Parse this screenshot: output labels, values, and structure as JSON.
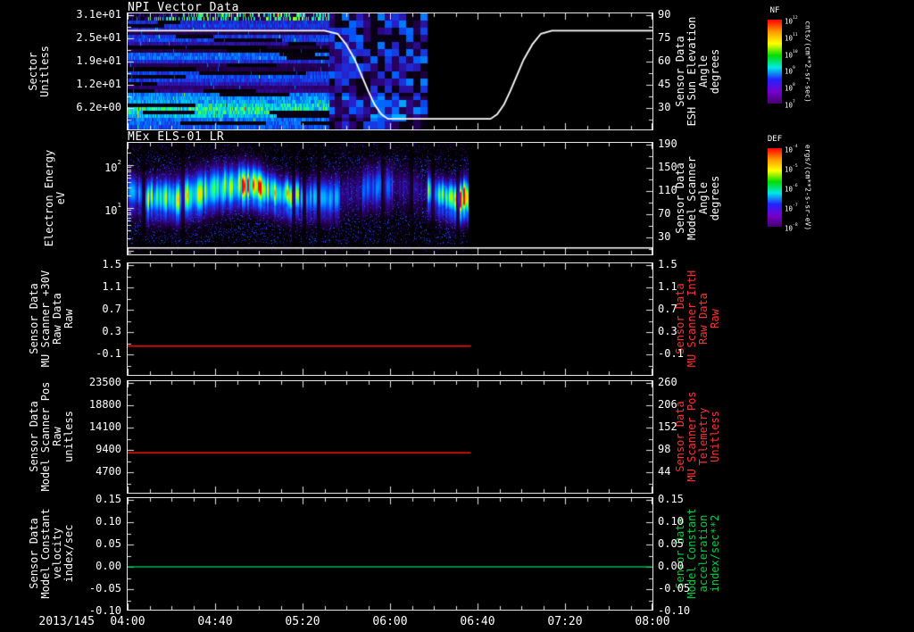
{
  "window": {
    "background": "#000000",
    "foreground": "#ffffff"
  },
  "x_axis": {
    "date_label": "2013/145",
    "tick_labels": [
      "04:00",
      "04:40",
      "05:20",
      "06:00",
      "06:40",
      "07:20",
      "08:00"
    ],
    "range_minutes": [
      0,
      240
    ],
    "major_tick_minutes": 40,
    "minor_tick_minutes": 10
  },
  "panels": [
    {
      "title": "NPI Vector Data",
      "left_label": "Sector\nUnitless",
      "left_ticks": [
        "3.1e+01",
        "2.5e+01",
        "1.9e+01",
        "1.2e+01",
        "6.2e+00"
      ],
      "right_label": "Sensor Data\nESH Sun Elevation\nAngle\ndegrees",
      "right_ticks": [
        "90",
        "75",
        "60",
        "45",
        "30"
      ],
      "right_label_color": "#ffffff"
    },
    {
      "title": "MEx ELS-01 LR",
      "left_label": "Electron Energy\neV",
      "left_ticks": [
        "10^2",
        "10^1"
      ],
      "right_label": "Sensor Data\nModel Scanner\nAngle\ndegrees",
      "right_ticks": [
        "190",
        "150",
        "110",
        "70",
        "30"
      ],
      "right_label_color": "#ffffff"
    },
    {
      "title": "",
      "left_label": "Sensor Data\nMU Scanner +30V\nRaw Data\nRaw",
      "left_ticks": [
        "1.5",
        "1.1",
        "0.7",
        "0.3",
        "-0.1"
      ],
      "right_label": "Sensor Data\nMU Scanner IntH\nRaw Data\nRaw",
      "right_ticks": [
        "1.5",
        "1.1",
        "0.7",
        "0.3",
        "-0.1"
      ],
      "right_label_color": "#ff3333"
    },
    {
      "title": "",
      "left_label": "Sensor Data\nModel Scanner Pos\nRaw\nunitless",
      "left_ticks": [
        "23500",
        "18800",
        "14100",
        "9400",
        "4700"
      ],
      "right_label": "Sensor Data\nMU Scanner Pos\nTelemetry\nUnitless",
      "right_ticks": [
        "260",
        "206",
        "152",
        "98",
        "44"
      ],
      "right_label_color": "#ff3333"
    },
    {
      "title": "",
      "left_label": "Sensor Data\nModel Constant\nvelocity\nindex/sec",
      "left_ticks": [
        "0.15",
        "0.10",
        "0.05",
        "0.00",
        "-0.05",
        "-0.10"
      ],
      "right_label": "Sensor Data\nModel Constant\nacceleration\nindex/sec**2",
      "right_ticks": [
        "0.15",
        "0.10",
        "0.05",
        "0.00",
        "-0.05",
        "-0.10"
      ],
      "right_label_color": "#00cc44"
    }
  ],
  "colorbars": [
    {
      "title": "NF",
      "units": "cnts/(cm**2-sr-sec)",
      "tick_labels": [
        "10^12",
        "10^11",
        "10^10",
        "10^9",
        "10^8",
        "10^7"
      ],
      "scale_colors": [
        "#ff0000",
        "#ff9900",
        "#ffff00",
        "#00dd00",
        "#00e8e8",
        "#2222ff",
        "#7700cc",
        "#44006e"
      ]
    },
    {
      "title": "DEF",
      "units": "ergs/(cm**2-s-sr-eV)",
      "tick_labels": [
        "10^-4",
        "10^-5",
        "10^-6",
        "10^-7",
        "10^-8"
      ],
      "scale_colors": [
        "#ff0000",
        "#ff9900",
        "#ffff00",
        "#00dd00",
        "#00e8e8",
        "#2222ff",
        "#7700cc",
        "#44006e"
      ]
    }
  ],
  "chart_data": [
    {
      "type": "heatmap",
      "panel": 1,
      "title": "NPI Vector Data",
      "ylabel": "Sector (Unitless)",
      "y_tick_labels": [
        "3.1e+01",
        "2.5e+01",
        "1.9e+01",
        "1.2e+01",
        "6.2e+00"
      ],
      "x_range_minutes": [
        0,
        240
      ],
      "x_tick_labels": [
        "04:00",
        "04:40",
        "05:20",
        "06:00",
        "06:40",
        "07:20",
        "08:00"
      ],
      "data_end_minute": 137,
      "colorbar": {
        "title": "NF",
        "units": "cnts/(cm**2-sr-sec)",
        "tick_labels": [
          "10^12",
          "10^11",
          "10^10",
          "10^9",
          "10^8",
          "10^7"
        ]
      },
      "summary": "32-sector azimuth spectrogram; mostly dim blue/purple counts with a bright cyan band near sectors 5-8, green speckle in top sectors and intermittent black data gaps until ~05:32; dim blocky purple data until ~06:17; no data afterwards.",
      "overlay_line": {
        "name": "ESH Sun Elevation Angle",
        "units": "degrees",
        "color": "#ffffff",
        "axis_ticks": [
          90,
          75,
          60,
          45,
          30
        ],
        "points": [
          [
            0,
            80
          ],
          [
            90,
            80
          ],
          [
            96,
            78
          ],
          [
            100,
            71
          ],
          [
            104,
            61
          ],
          [
            107,
            51
          ],
          [
            110,
            41
          ],
          [
            113,
            32
          ],
          [
            116,
            26
          ],
          [
            119,
            23
          ],
          [
            166,
            23
          ],
          [
            169,
            26
          ],
          [
            172,
            32
          ],
          [
            175,
            41
          ],
          [
            178,
            51
          ],
          [
            181,
            61
          ],
          [
            185,
            71
          ],
          [
            189,
            78
          ],
          [
            194,
            80
          ],
          [
            240,
            80
          ]
        ]
      }
    },
    {
      "type": "heatmap",
      "panel": 2,
      "title": "MEx ELS-01 LR",
      "ylabel": "Electron Energy (eV)",
      "y_scale": "log",
      "y_tick_labels": [
        "10^2",
        "10^1"
      ],
      "x_range_minutes": [
        0,
        240
      ],
      "data_end_minute": 156,
      "colorbar": {
        "title": "DEF",
        "units": "ergs/(cm**2-s-sr-eV)",
        "tick_labels": [
          "10^-4",
          "10^-5",
          "10^-6",
          "10^-7",
          "10^-8"
        ]
      },
      "summary": "Electron energy-time spectrogram 04:00-06:36; intense green/yellow flux band near 10-60 eV with red cores around 04:50-05:00 and 06:28-06:36, weak dark interval ~05:35-06:15, blue speckle background; no data after ~06:36.",
      "overlay_line": {
        "name": "Model Scanner Angle",
        "units": "degrees",
        "color": "#ffffff",
        "value": 12,
        "x_extent_minutes": [
          0,
          240
        ]
      },
      "right_axis": {
        "label": "Sensor Data Model Scanner Angle (degrees)",
        "tick_labels": [
          190,
          150,
          110,
          70,
          30
        ]
      }
    },
    {
      "type": "line",
      "panel": 3,
      "ylim_left": [
        -0.5,
        1.5
      ],
      "left_tick_labels": [
        1.5,
        1.1,
        0.7,
        0.3,
        -0.1
      ],
      "right_tick_labels": [
        1.5,
        1.1,
        0.7,
        0.3,
        -0.1
      ],
      "series": [
        {
          "name": "MU Scanner +30V Raw Data Raw",
          "color": "#ff1515",
          "value": 0.05,
          "x_extent_minutes": [
            0,
            157
          ]
        }
      ]
    },
    {
      "type": "line",
      "panel": 4,
      "ylim_left": [
        0,
        23500
      ],
      "left_tick_labels": [
        23500,
        18800,
        14100,
        9400,
        4700
      ],
      "right_tick_labels": [
        260,
        206,
        152,
        98,
        44
      ],
      "series": [
        {
          "name": "Model Scanner Pos Raw unitless",
          "color": "#ff1515",
          "value": 8800,
          "x_extent_minutes": [
            0,
            157
          ]
        }
      ]
    },
    {
      "type": "line",
      "panel": 5,
      "ylim_left": [
        -0.1,
        0.15
      ],
      "left_tick_labels": [
        0.15,
        0.1,
        0.05,
        0.0,
        -0.05,
        -0.1
      ],
      "right_tick_labels": [
        0.15,
        0.1,
        0.05,
        0.0,
        -0.05,
        -0.1
      ],
      "series": [
        {
          "name": "Model Constant velocity index/sec",
          "color": "#00b450",
          "value": 0.0,
          "x_extent_minutes": [
            0,
            240
          ]
        }
      ]
    }
  ]
}
